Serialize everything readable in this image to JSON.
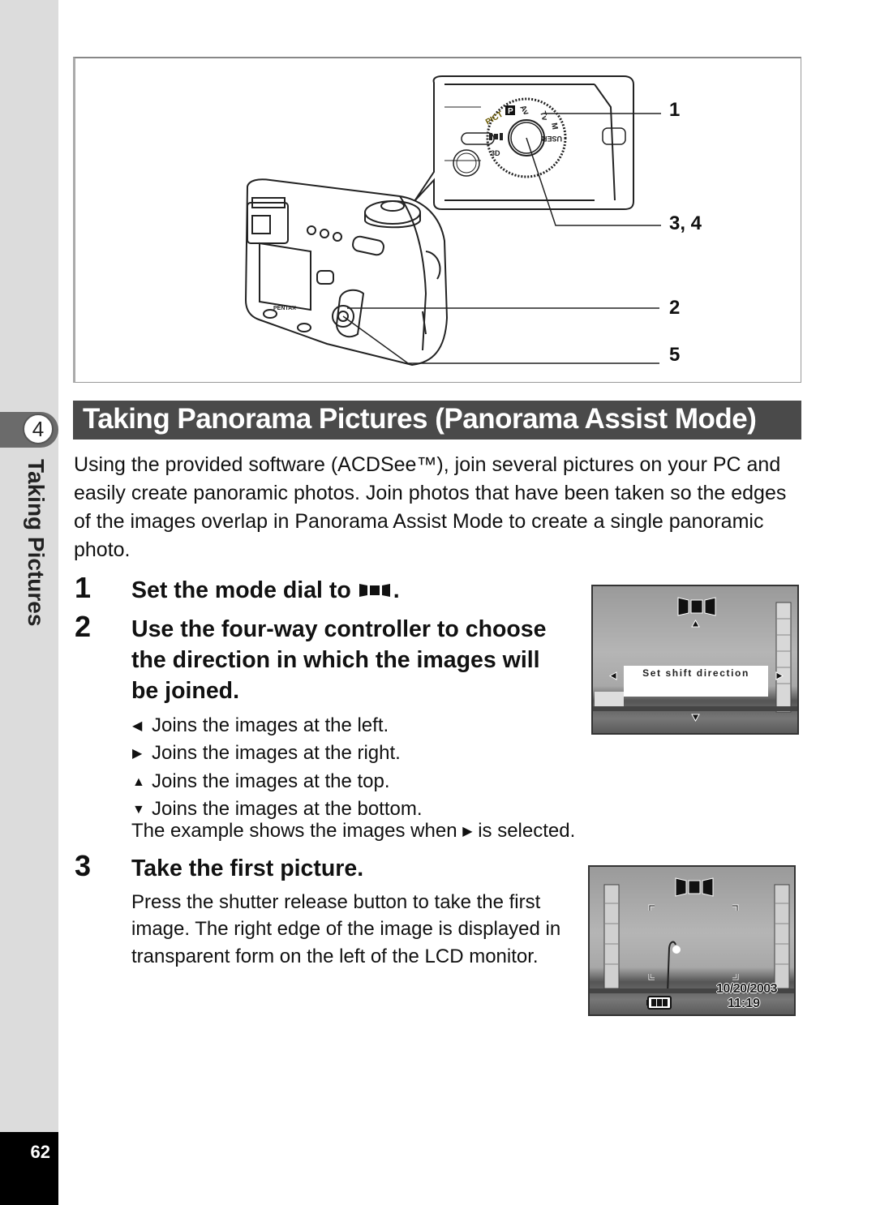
{
  "sidebar": {
    "chapter_number": "4",
    "chapter_title": "Taking Pictures",
    "page_number": "62"
  },
  "figure": {
    "callouts": [
      "1",
      "3, 4",
      "2",
      "5"
    ],
    "camera_brand": "PENTAX",
    "mode_dial_labels": [
      "P",
      "Av",
      "Tv",
      "M",
      "USER",
      "PICT",
      "3D"
    ]
  },
  "section": {
    "title": "Taking Panorama Pictures (Panorama Assist Mode)",
    "intro": "Using the provided software (ACDSee™), join several pictures on your PC and easily create panoramic photos. Join photos that have been taken so the edges of the images overlap in Panorama Assist Mode to create a single panoramic photo."
  },
  "steps": [
    {
      "number": "1",
      "heading": "Set the mode dial to",
      "heading_icon": "panorama-mode-icon",
      "heading_suffix": "."
    },
    {
      "number": "2",
      "heading": "Use the four-way controller to choose the direction in which the images will be joined."
    },
    {
      "number": "3",
      "heading": "Take the first picture.",
      "body": "Press the shutter release button to take the first image. The right edge of the image is displayed in transparent form on the left of the LCD monitor."
    }
  ],
  "directions": [
    {
      "icon": "left-arrow-icon",
      "glyph": "◀",
      "text": "Joins the images at the left."
    },
    {
      "icon": "right-arrow-icon",
      "glyph": "▶",
      "text": "Joins the images at the right."
    },
    {
      "icon": "up-arrow-icon",
      "glyph": "▲",
      "text": "Joins the images at the top."
    },
    {
      "icon": "down-arrow-icon",
      "glyph": "▼",
      "text": "Joins the images at the bottom."
    }
  ],
  "example": {
    "before": "The example shows the images when",
    "glyph": "▶",
    "after": "is selected."
  },
  "lcd1": {
    "message": "Set shift direction"
  },
  "lcd2": {
    "date": "10/20/2003",
    "time": "11:19"
  }
}
